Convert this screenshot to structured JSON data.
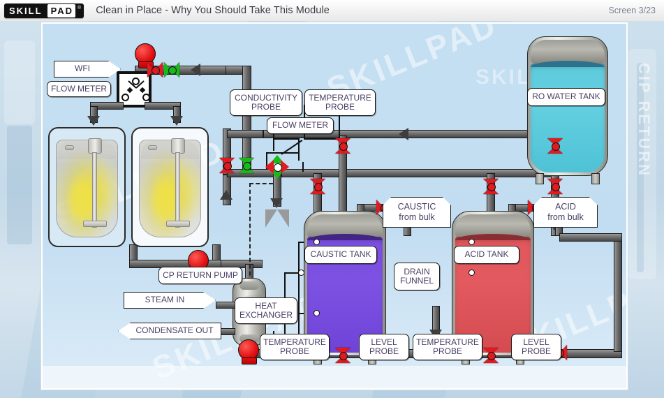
{
  "header": {
    "logo_part1": "SKILL",
    "logo_part2": "PAD",
    "logo_reg": "®",
    "title": "Clean in Place - Why You Should Take This Module",
    "screen_counter": "Screen 3/23"
  },
  "diagram": {
    "background_watermarks": [
      "SKILLPAD",
      "SKILLPAD",
      "SKILLPAD",
      "SKILLPAD"
    ],
    "side_watermark": "CIP RETURN",
    "labels": {
      "wfi": "WFI",
      "flow_meter_left": "FLOW METER",
      "conductivity_probe": "CONDUCTIVITY\nPROBE",
      "temperature_probe_top": "TEMPERATURE\nPROBE",
      "flow_meter_mid": "FLOW METER",
      "ro_water_tank": "RO WATER TANK",
      "caustic_from_bulk": "CAUSTIC\nfrom bulk",
      "acid_from_bulk": "ACID\nfrom bulk",
      "caustic_tank": "CAUSTIC TANK",
      "acid_tank": "ACID TANK",
      "drain_funnel": "DRAIN\nFUNNEL",
      "cp_return_pump": "CP RETURN PUMP",
      "steam_in": "STEAM IN",
      "heat_exchanger": "HEAT\nEXCHANGER",
      "condensate_out": "CONDENSATE OUT",
      "temperature_probe_hx": "TEMPERATURE\nPROBE",
      "level_probe_caustic": "LEVEL\nPROBE",
      "temperature_probe_acid": "TEMPERATURE\nPROBE",
      "level_probe_acid": "LEVEL\nPROBE"
    },
    "colors": {
      "ro_water": "#5ecbdd",
      "caustic": "#7b4fe0",
      "acid": "#e0575c",
      "valve_closed": "#e01b20",
      "valve_open": "#17bb17",
      "pump": "#e00d10",
      "pipe": "#6e6e6e",
      "field": "#c5dff2"
    },
    "equipment": {
      "bioreactors": 2,
      "tanks": [
        "RO WATER TANK",
        "CAUSTIC TANK",
        "ACID TANK"
      ],
      "pumps": 3,
      "valves_closed": 16,
      "valves_open": 4
    }
  }
}
